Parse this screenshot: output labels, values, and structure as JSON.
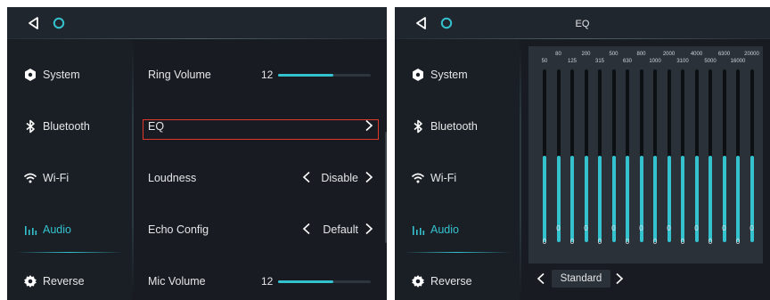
{
  "sidebar": {
    "items": [
      {
        "label": "System",
        "icon": "hexagon-icon",
        "active": false
      },
      {
        "label": "Bluetooth",
        "icon": "bluetooth-icon",
        "active": false
      },
      {
        "label": "Wi-Fi",
        "icon": "wifi-icon",
        "active": false
      },
      {
        "label": "Audio",
        "icon": "equalizer-icon",
        "active": true
      },
      {
        "label": "Reverse",
        "icon": "gear-icon",
        "active": false
      }
    ]
  },
  "audio_settings": {
    "ring_volume": {
      "label": "Ring Volume",
      "value": "12",
      "level": 0.6
    },
    "eq": {
      "label": "EQ"
    },
    "loudness": {
      "label": "Loudness",
      "value": "Disable"
    },
    "echo_config": {
      "label": "Echo Config",
      "value": "Default"
    },
    "mic_volume": {
      "label": "Mic Volume",
      "value": "12",
      "level": 0.6
    }
  },
  "eq_screen": {
    "title": "EQ",
    "frequencies": [
      "50",
      "80",
      "125",
      "200",
      "315",
      "500",
      "630",
      "800",
      "1000",
      "2000",
      "3100",
      "4000",
      "5000",
      "6300",
      "16000",
      "20000"
    ],
    "values": [
      "0",
      "0",
      "0",
      "0",
      "0",
      "0",
      "0",
      "0",
      "0",
      "0",
      "0",
      "0",
      "0",
      "0",
      "0",
      "0"
    ],
    "levels": [
      0.5,
      0.5,
      0.5,
      0.5,
      0.5,
      0.5,
      0.5,
      0.5,
      0.5,
      0.5,
      0.5,
      0.5,
      0.5,
      0.5,
      0.5,
      0.5
    ],
    "preset": "Standard"
  },
  "colors": {
    "accent": "#35c2cf",
    "background": "#181c22",
    "highlight_border": "#e0392b"
  }
}
